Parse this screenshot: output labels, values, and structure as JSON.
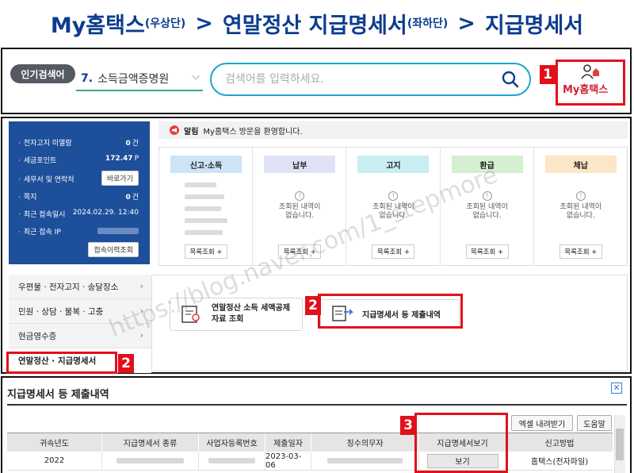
{
  "heading": {
    "part1": "My홈택스",
    "part1_note": "(우상단)",
    "sep1": ">",
    "part2": "연말정산 지급명세서",
    "part2_note": "(좌하단)",
    "sep2": ">",
    "part3": "지급명세서"
  },
  "topbar": {
    "popular_badge": "인기검색어",
    "popular_rank": "7.",
    "popular_term": "소득금액증명원",
    "search_placeholder": "검색어를 입력하세요.",
    "myhometax_label": "My홈택스",
    "step_marker": "1"
  },
  "sidebar": {
    "rows": [
      {
        "label": "전자고지 미열람",
        "value": "0",
        "unit": "건"
      },
      {
        "label": "세금포인트",
        "value": "172.47",
        "unit": "P"
      },
      {
        "label": "세무서 및 연락처",
        "button": "바로가기"
      },
      {
        "label": "쪽지",
        "value": "0",
        "unit": "건"
      },
      {
        "label": "최근 접속일시",
        "value": "2024.02.29.  12:40"
      },
      {
        "label": "최근 접속 IP"
      }
    ],
    "history_button": "접속이력조회"
  },
  "notice": {
    "title": "알림",
    "message": "My홈택스 방문을 환영합니다."
  },
  "cards": [
    {
      "title": "신고·소득",
      "color": "#cfe3f7",
      "button": "목록조회 +"
    },
    {
      "title": "납부",
      "color": "#dfe3f5",
      "message_line1": "조회된 내역이",
      "message_line2": "없습니다.",
      "button": "목록조회 +"
    },
    {
      "title": "고지",
      "color": "#c8eef2",
      "message_line1": "조회된 내역이",
      "message_line2": "없습니다.",
      "button": "목록조회 +"
    },
    {
      "title": "환급",
      "color": "#d4f0d0",
      "message_line1": "조회된 내역이",
      "message_line2": "없습니다.",
      "button": "목록조회 +"
    },
    {
      "title": "체납",
      "color": "#fbe6c8",
      "message_line1": "조회된 내역이",
      "message_line2": "없습니다.",
      "button": "목록조회 +"
    }
  ],
  "left_menu": {
    "items": [
      {
        "label": "우편물 · 전자고지 · 송달장소"
      },
      {
        "label": "민원 · 상담 · 불복 · 고충"
      },
      {
        "label": "현금영수증"
      },
      {
        "label": "연말정산 · 지급명세서"
      }
    ],
    "step_marker": "2"
  },
  "sub_cards": {
    "card1_line1": "연말정산 소득 세액공제",
    "card1_line2": "자료 조회",
    "card2": "지급명세서 등 제출내역",
    "step_marker": "2"
  },
  "watermark": "https://blog.naver.com/1_stepmore",
  "result": {
    "title": "지급명세서 등 제출내역",
    "excel_button": "엑셀 내려받기",
    "help_button": "도움말",
    "step_marker": "3",
    "columns": [
      "귀속년도",
      "지급명세서 종류",
      "사업자등록번호",
      "제출일자",
      "징수의무자",
      "지급명세서보기",
      "신고방법"
    ],
    "row": {
      "year": "2022",
      "submit_date": "2023-03-06",
      "view_button": "보기",
      "method": "홈택스(전자파일)"
    }
  },
  "colors": {
    "brand_blue": "#0b3d8f",
    "marker_red": "#e2101a",
    "sidebar_blue": "#1d4f9b",
    "search_border": "#1ca6c8"
  }
}
